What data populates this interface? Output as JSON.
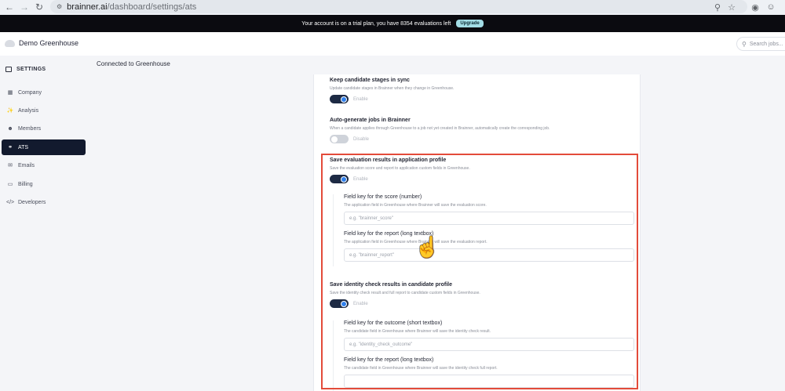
{
  "browser": {
    "url_host": "brainner.ai",
    "url_path": "/dashboard/settings/ats"
  },
  "banner": {
    "text": "Your account is on a trial plan, you have 8354 evaluations left",
    "upgrade_label": "Upgrade"
  },
  "header": {
    "org_name": "Demo Greenhouse",
    "search_placeholder": "Search jobs..."
  },
  "sidebar": {
    "title": "SETTINGS",
    "items": [
      {
        "label": "Company",
        "icon": "building-icon"
      },
      {
        "label": "Analysis",
        "icon": "analysis-icon"
      },
      {
        "label": "Members",
        "icon": "members-icon"
      },
      {
        "label": "ATS",
        "icon": "plug-icon"
      },
      {
        "label": "Emails",
        "icon": "mail-icon"
      },
      {
        "label": "Billing",
        "icon": "card-icon"
      },
      {
        "label": "Developers",
        "icon": "code-icon"
      }
    ],
    "active": "ATS"
  },
  "main": {
    "heading": "Connected to Greenhouse",
    "sections": [
      {
        "title": "Keep candidate stages in sync",
        "desc": "Update candidate stages in Brainner when they change in Greenhouse.",
        "toggle_label": "Enable",
        "enabled": true
      },
      {
        "title": "Auto-generate jobs in Brainner",
        "desc": "When a candidate applies through Greenhouse to a job not yet created in Brainner, automatically create the corresponding job.",
        "toggle_label": "Disable",
        "enabled": false
      },
      {
        "title": "Save evaluation results in application profile",
        "desc": "Save the evaluation score and report to application custom fields in Greenhouse.",
        "toggle_label": "Enable",
        "enabled": true,
        "fields": [
          {
            "title": "Field key for the score (number)",
            "desc": "The application field in Greenhouse where Brainner will save the evaluation score.",
            "placeholder": "e.g. \"brainner_score\""
          },
          {
            "title": "Field key for the report (long textbox)",
            "desc": "The application field in Greenhouse where Brainner will save the evaluation report.",
            "placeholder": "e.g. \"brainner_report\""
          }
        ]
      },
      {
        "title": "Save identity check results in candidate profile",
        "desc": "Save the identity check result and full report to candidate custom fields in Greenhouse.",
        "toggle_label": "Enable",
        "enabled": true,
        "fields": [
          {
            "title": "Field key for the outcome (short textbox)",
            "desc": "The candidate field in Greenhouse where Brainner will save the identity check result.",
            "placeholder": "e.g. \"identity_check_outcome\""
          },
          {
            "title": "Field key for the report (long textbox)",
            "desc": "The candidate field in Greenhouse where Brainner will save the identity check full report.",
            "placeholder": ""
          }
        ]
      }
    ]
  },
  "colors": {
    "highlight": "#e34b3a",
    "sidebar_active": "#121a2e",
    "toggle_on_knob": "#2f80ed"
  }
}
